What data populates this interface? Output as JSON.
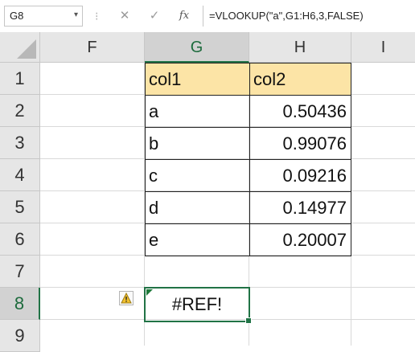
{
  "formula_bar": {
    "name_box": "G8",
    "name_box_arrow": "▾",
    "separator": "⁝",
    "cancel": "✕",
    "enter": "✓",
    "fx": "fx",
    "formula": "=VLOOKUP(\"a\",G1:H6,3,FALSE)"
  },
  "columns": [
    "F",
    "G",
    "H",
    "I"
  ],
  "active_column": "G",
  "rows": [
    "1",
    "2",
    "3",
    "4",
    "5",
    "6",
    "7",
    "8",
    "9"
  ],
  "active_row": "8",
  "table": {
    "header": {
      "col1": "col1",
      "col2": "col2"
    },
    "rows": [
      {
        "col1": "a",
        "col2": "0.50436"
      },
      {
        "col1": "b",
        "col2": "0.99076"
      },
      {
        "col1": "c",
        "col2": "0.09216"
      },
      {
        "col1": "d",
        "col2": "0.14977"
      },
      {
        "col1": "e",
        "col2": "0.20007"
      }
    ]
  },
  "result_cell": {
    "value": "#REF!"
  },
  "colors": {
    "header_fill": "#fce4a6",
    "active_green": "#217346",
    "warning_yellow": "#f2c12e"
  },
  "icons": {
    "warning": "warning-triangle-icon",
    "error_indicator": "error-indicator-icon"
  }
}
